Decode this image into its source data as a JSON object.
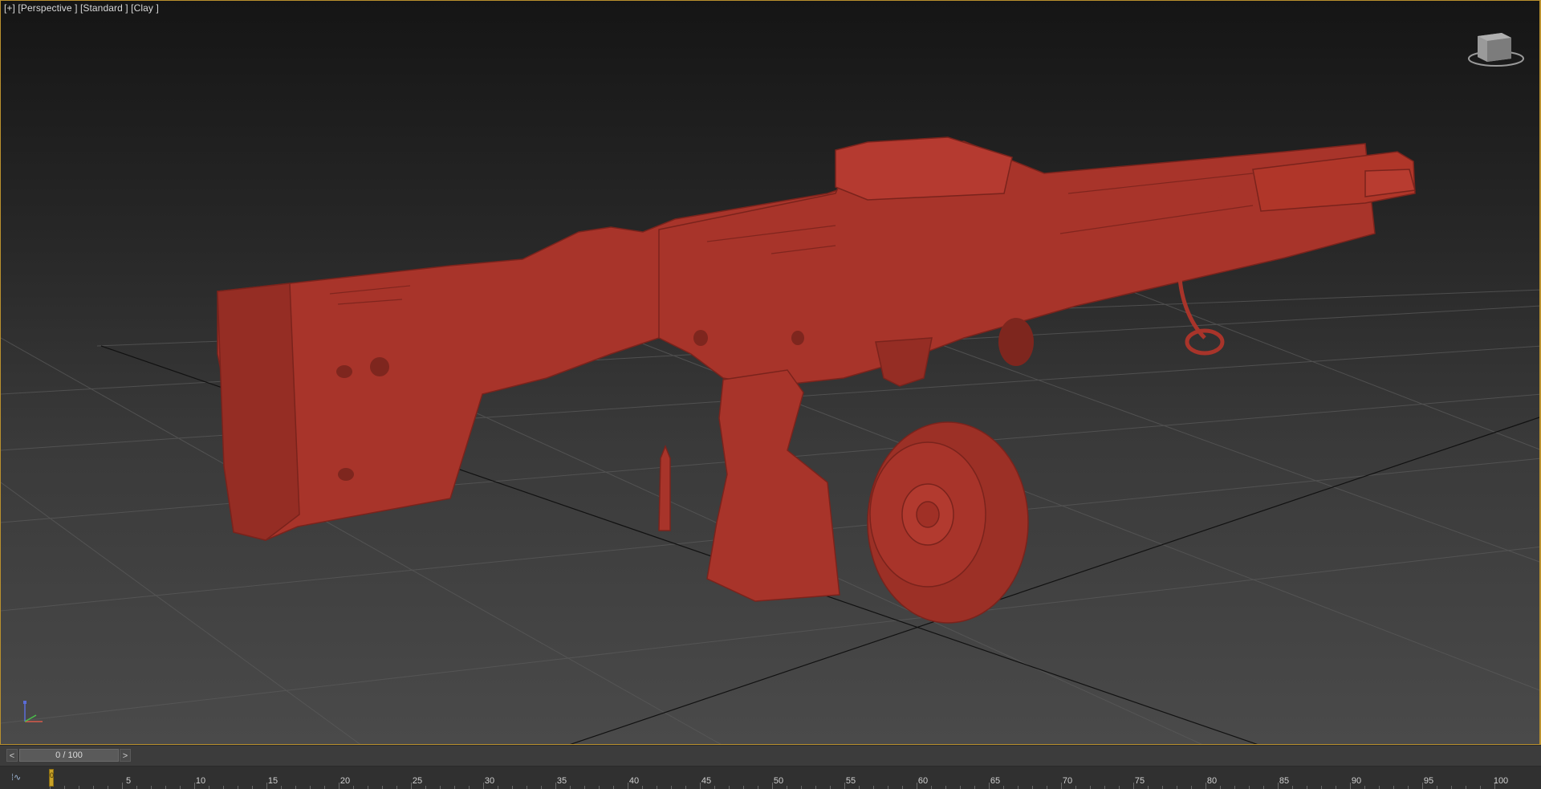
{
  "viewport": {
    "label": "[+] [Perspective ] [Standard ] [Clay ]",
    "model_color": "#a8342a",
    "border_color": "#b9902e"
  },
  "viewcube": {
    "icon": "viewcube-icon"
  },
  "axis_tripod": {
    "icon": "axis-tripod-icon"
  },
  "timeslider": {
    "prev_label": "<",
    "next_label": ">",
    "frame_display": "0 / 100"
  },
  "trackbar": {
    "curve_label": "⁞∿",
    "current_frame": 0,
    "marker_label": "0",
    "ticks": [
      "5",
      "10",
      "15",
      "20",
      "25",
      "30",
      "35",
      "40",
      "45",
      "50",
      "55",
      "60",
      "65",
      "70",
      "75",
      "80",
      "85",
      "90",
      "95",
      "100"
    ]
  }
}
